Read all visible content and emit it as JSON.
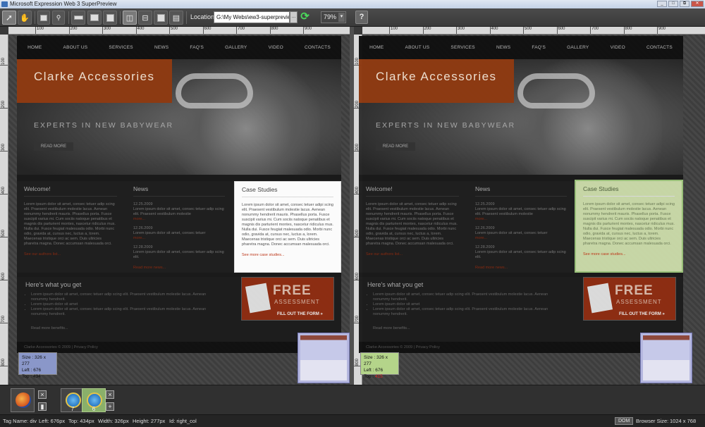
{
  "window": {
    "title": "Microsoft Expression Web 3 SuperPreview",
    "controls": [
      "_",
      "□",
      "⧉",
      "✕"
    ]
  },
  "toolbar": {
    "location_label": "Location:",
    "location_value": "G:\\My Webs\\ew3-superpreview-exar",
    "zoom_value": "79%",
    "help_glyph": "?"
  },
  "ruler": {
    "ticks": [
      "100",
      "200",
      "300",
      "400",
      "500",
      "600",
      "700",
      "800",
      "900"
    ],
    "vticks": [
      "100",
      "200",
      "300",
      "400",
      "500",
      "600",
      "700",
      "800"
    ]
  },
  "site": {
    "nav": [
      "HOME",
      "ABOUT US",
      "SERVICES",
      "NEWS",
      "FAQ'S",
      "GALLERY",
      "VIDEO",
      "CONTACTS"
    ],
    "logo": "Clarke Accessories",
    "tagline": "EXPERTS IN NEW BABYWEAR",
    "read_more": "READ MORE",
    "welcome_title": "Welcome!",
    "welcome_text": "Lorem ipsum dolor sit amet, consec tetuer adip scing elit. Praesent vestibulum molestie lacus. Aenean nonummy hendrerit mauris. Phasellus porta. Fusce suscipit varius mi. Cum sociis natoque penatibus et magnis dis parturient montes, nascetur ridiculus mus. Nulla dui. Fusce feugiat malesuada odio. Morbi nunc odio, gravida at, cursus nec, luctus a, lorem. Maecenas tristique orci ac sem. Duis ultricies pharetra magna. Donec accumsan malesuada orci.",
    "welcome_link": "See our authors list...",
    "news_title": "News",
    "news_items": [
      {
        "date": "12.25.2009",
        "text": "Lorem ipsum dolor sit amet, consec tetuer adip scing elit. Praesent vestibulum molestie"
      },
      {
        "date": "12.26.2009",
        "text": "Lorem ipsum dolor sit amet, consec tetuer"
      },
      {
        "date": "12.28.2009",
        "text": "Lorem ipsum dolor sit amet, consec tetuer adip scing elit."
      }
    ],
    "news_more": "more...",
    "news_link": "Read more news...",
    "cs_title": "Case Studies",
    "cs_text": "Lorem ipsum dolor sit amet, consec tetuer adipi scing elit. Praesent vestibulum molestie lacus. Aenean nonummy hendrerit mauris. Phasellus porta. Fusce suscipit varius mi. Cum sociis natoque penatibus et magnis dis parturient montes, nascetur ridiculus mus. Nulla dui. Fusce feugiat malesuada odio. Morbi nunc odio, gravida at, cursus nec, luctus a, lorem. Maecenas tristique orci ac sem. Duis ultricies pharetra magna. Donec accumsan malesuada orci.",
    "cs_link": "See more case studies...",
    "get_title": "Here's what you get",
    "get_items": [
      "Lorem ipsum dolor sit amet, consec tetuer adip scing elit. Praesent vestibulum molestie lacus. Aenean nonummy hendrerit.",
      "Lorem ipsum dolor sit amet",
      "Lorem ipsum dolor sit amet, consec tetuer adip scing elit. Praesent vestibulum molestie lacus. Aenean nonummy hendrerit."
    ],
    "get_link": "Read more benefits...",
    "free_big": "FREE",
    "free_small": "ASSESSMENT",
    "free_fill": "FILL OUT THE FORM »",
    "footer": "Clarke Accessories © 2009 | Privacy Policy"
  },
  "left_info": {
    "size": "Size : 326 x 277",
    "left": "Left : 676",
    "top": "Top : 434"
  },
  "right_info": {
    "size": "Size : 326 x 277",
    "left": "Left : 676",
    "top_label": "Top : ",
    "top_value": "415"
  },
  "sessions": {
    "browser1_num": "7",
    "browser2_num": "6"
  },
  "status": {
    "tag_name": "Tag Name: div",
    "left": "Left: 676px",
    "top": "Top: 434px",
    "width": "Width: 326px",
    "height": "Height: 277px",
    "id": "Id: right_col",
    "dom": "DOM",
    "browser_size_label": "Browser Size:",
    "browser_size": "1024 x 768"
  }
}
